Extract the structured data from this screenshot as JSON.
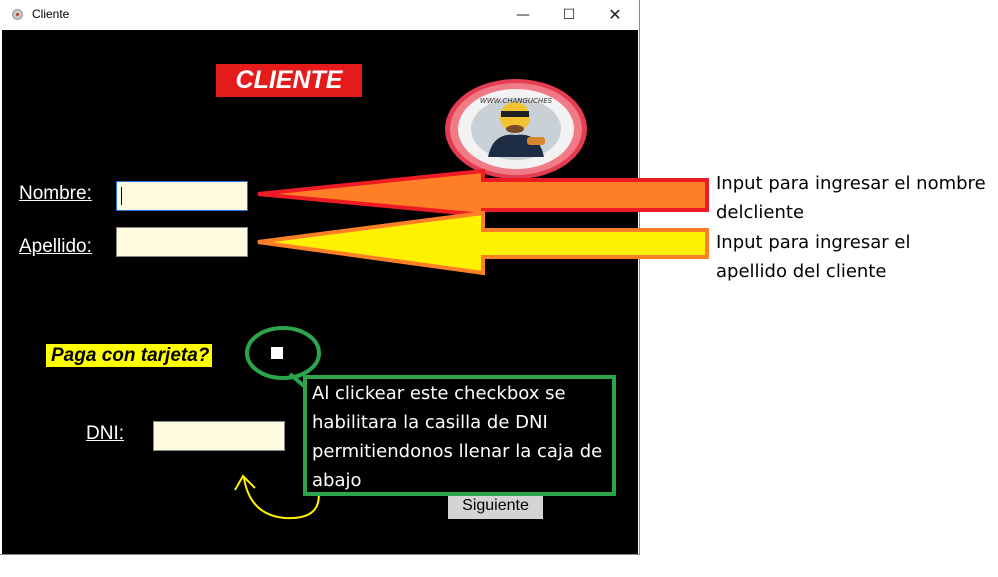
{
  "window": {
    "title": "Cliente",
    "controls": {
      "minimize": "—",
      "maximize": "☐",
      "close": "✕"
    }
  },
  "form": {
    "title": "CLIENTE",
    "nombre_label": "Nombre:",
    "nombre_value": "",
    "apellido_label": "Apellido:",
    "apellido_value": "",
    "paga_label": "Paga con tarjeta?",
    "tarjeta_checked": false,
    "dni_label": "DNI:",
    "dni_value": "",
    "siguiente_label": "Siguiente",
    "logo_text": "WWW.CHANGUCHES"
  },
  "annotations": {
    "nombre_note": "Input para ingresar el nombre delcliente",
    "apellido_note": "Input para ingresar el apellido del cliente",
    "checkbox_note": "Al clickear este checkbox se habilitara la casilla de DNI permitiendonos llenar la caja de abajo"
  },
  "colors": {
    "title_bg": "#e51a1a",
    "form_bg": "#000000",
    "input_bg": "#fefbe0",
    "paga_bg": "#ffff00",
    "arrow_nombre_fill": "#ff7f27",
    "arrow_nombre_stroke": "#ed1c24",
    "arrow_apellido_fill": "#fff200",
    "arrow_apellido_stroke": "#ff7f27",
    "callout_border": "#2ba44a",
    "curved_arrow": "#fff200"
  }
}
